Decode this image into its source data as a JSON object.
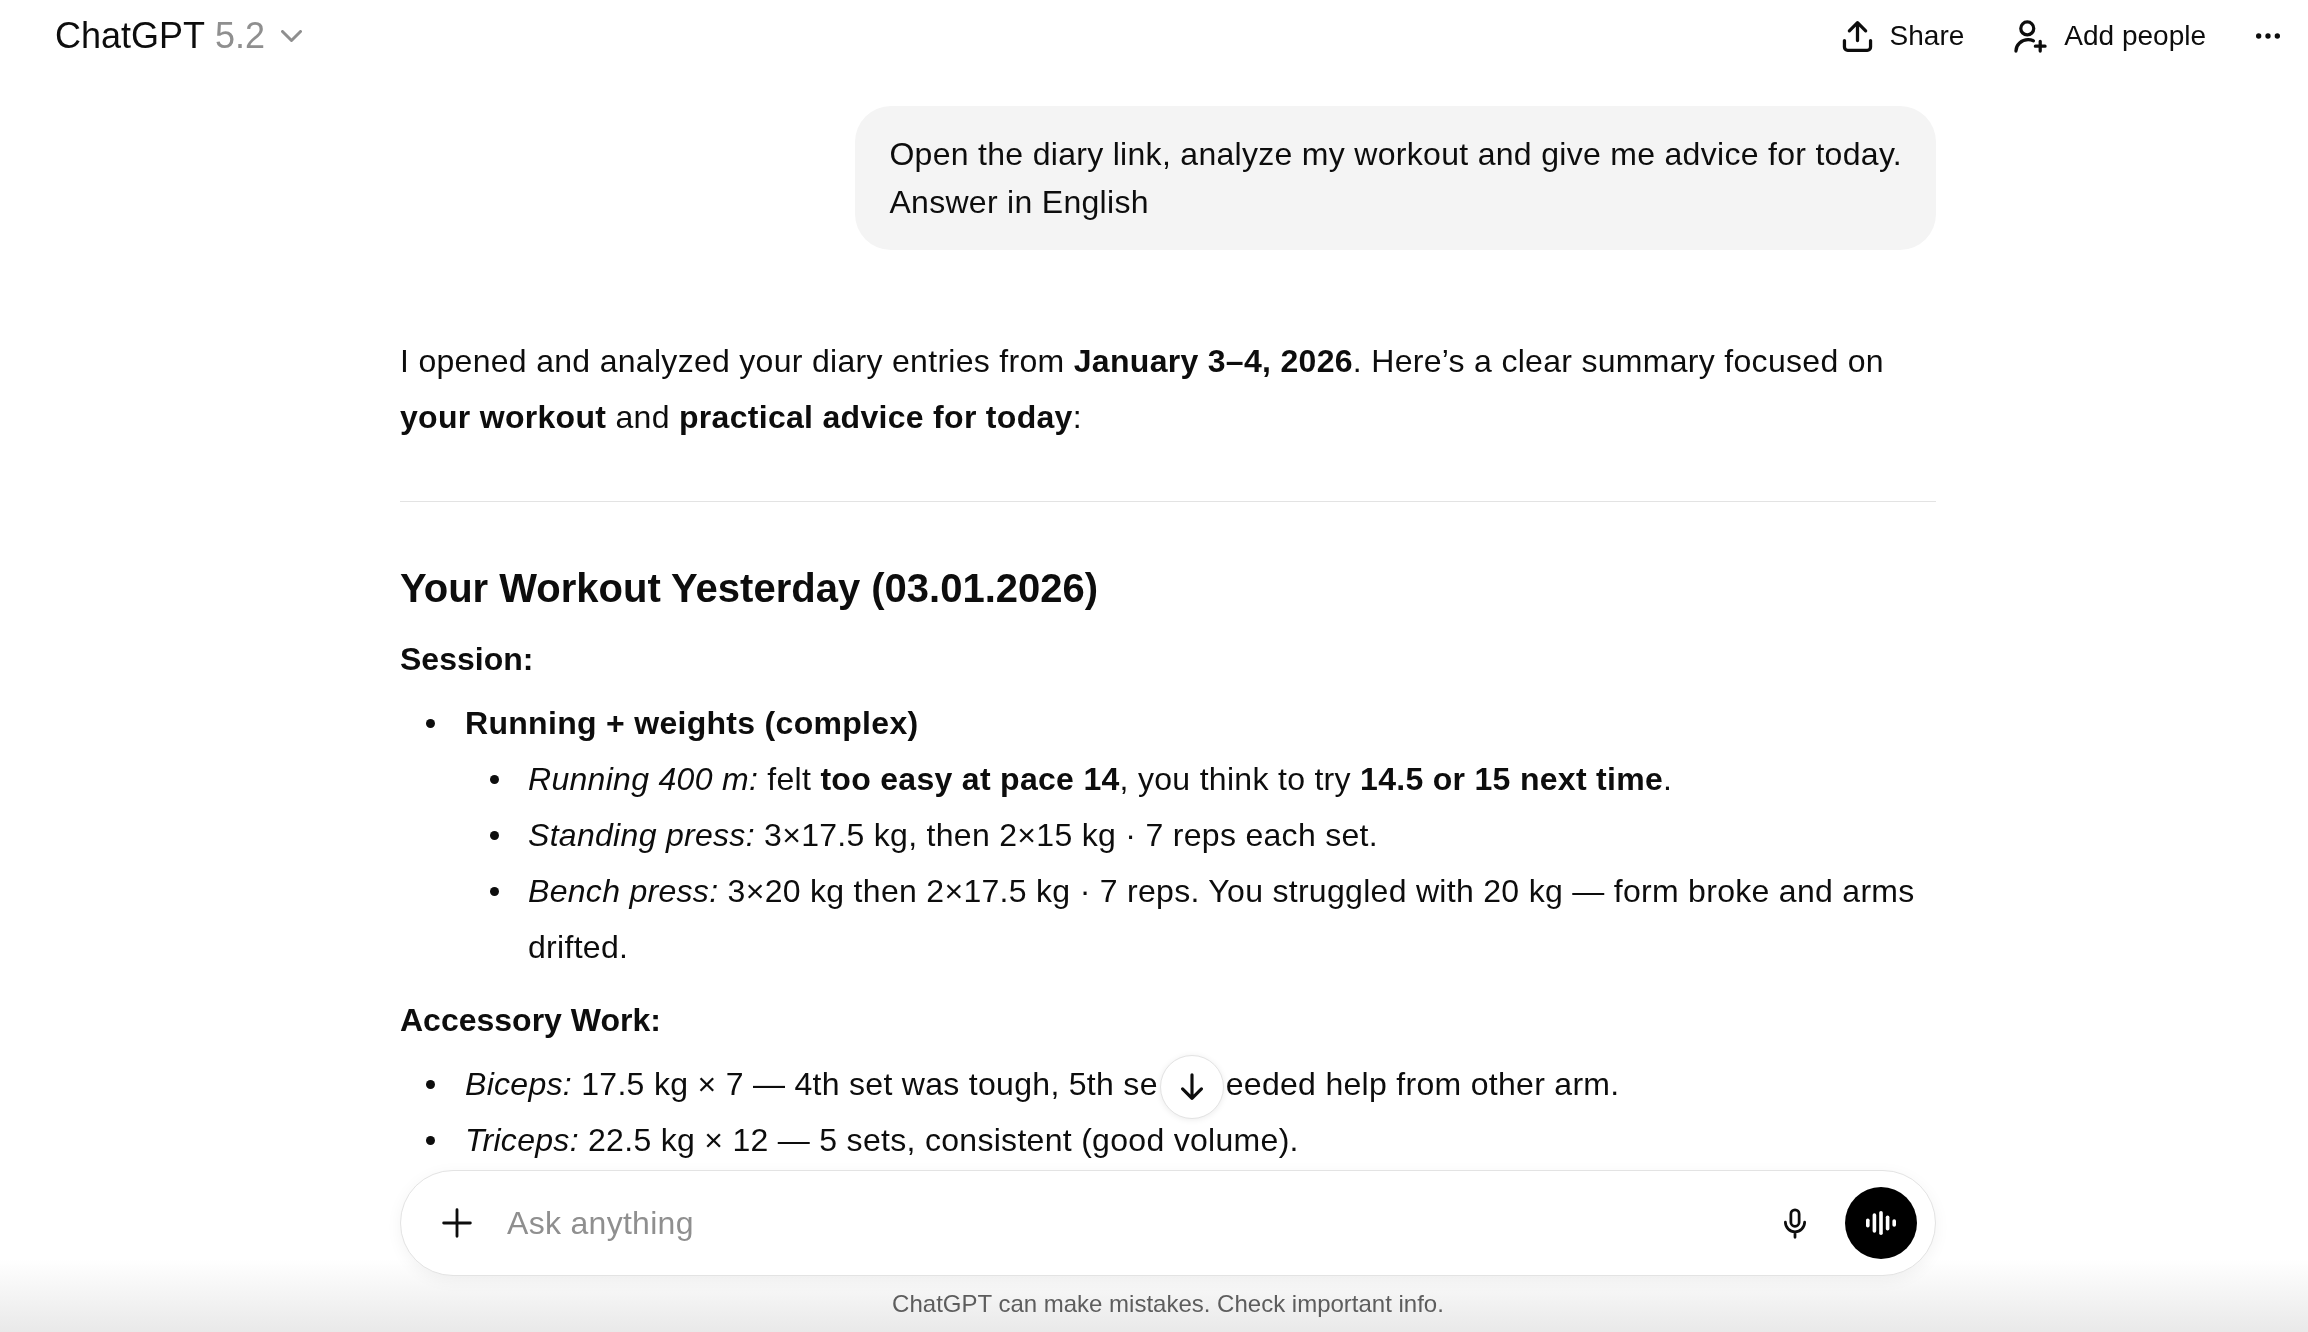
{
  "header": {
    "title": "ChatGPT",
    "model": "5.2",
    "actions": [
      {
        "kind": "share",
        "label": "Share"
      },
      {
        "kind": "add_people",
        "label": "Add people"
      },
      {
        "kind": "more"
      }
    ]
  },
  "conversation": [
    {
      "kind": "user",
      "text": "Open the diary link, analyze my workout and give me advice for today.\nAnswer in English"
    },
    {
      "kind": "assistant",
      "blocks": [
        {
          "kind": "paragraph",
          "text": "I opened and analyzed your diary entries from **January 3–4, 2026**. Here’s a clear summary focused on **your workout** and **practical advice for today**:"
        },
        {
          "kind": "rule"
        },
        {
          "kind": "heading",
          "text": "Your Workout Yesterday (03.01.2026)"
        },
        {
          "kind": "label",
          "text": "Session:"
        },
        {
          "kind": "list",
          "items": [
            {
              "text": "Running + weights (complex)",
              "bold": true,
              "children": [
                {
                  "text": "*Running 400 m:* felt **too easy at pace 14**, you think to try **14.5 or 15 next time**.",
                  "bold": false
                },
                {
                  "text": "*Standing press:* 3×17.5 kg, then 2×15 kg · 7 reps each set.",
                  "bold": false
                },
                {
                  "text": "*Bench press:* 3×20 kg then 2×17.5 kg · 7 reps. You struggled with 20 kg — form broke and arms drifted.",
                  "bold": false
                }
              ]
            }
          ]
        },
        {
          "kind": "label",
          "text": "Accessory Work:"
        },
        {
          "kind": "list",
          "items": [
            {
              "segments": [
                "*Biceps:* 17.5 kg × 7 — 4th set was tough, 5th se",
                "eeded help from other arm."
              ],
              "bold": false
            },
            {
              "text": "*Triceps:* 22.5 kg × 12 — 5 sets, consistent (good volume).",
              "bold": false
            }
          ]
        }
      ]
    }
  ],
  "composer": {
    "placeholder": "Ask anything"
  },
  "disclaimer": "ChatGPT can make mistakes. Check important info."
}
